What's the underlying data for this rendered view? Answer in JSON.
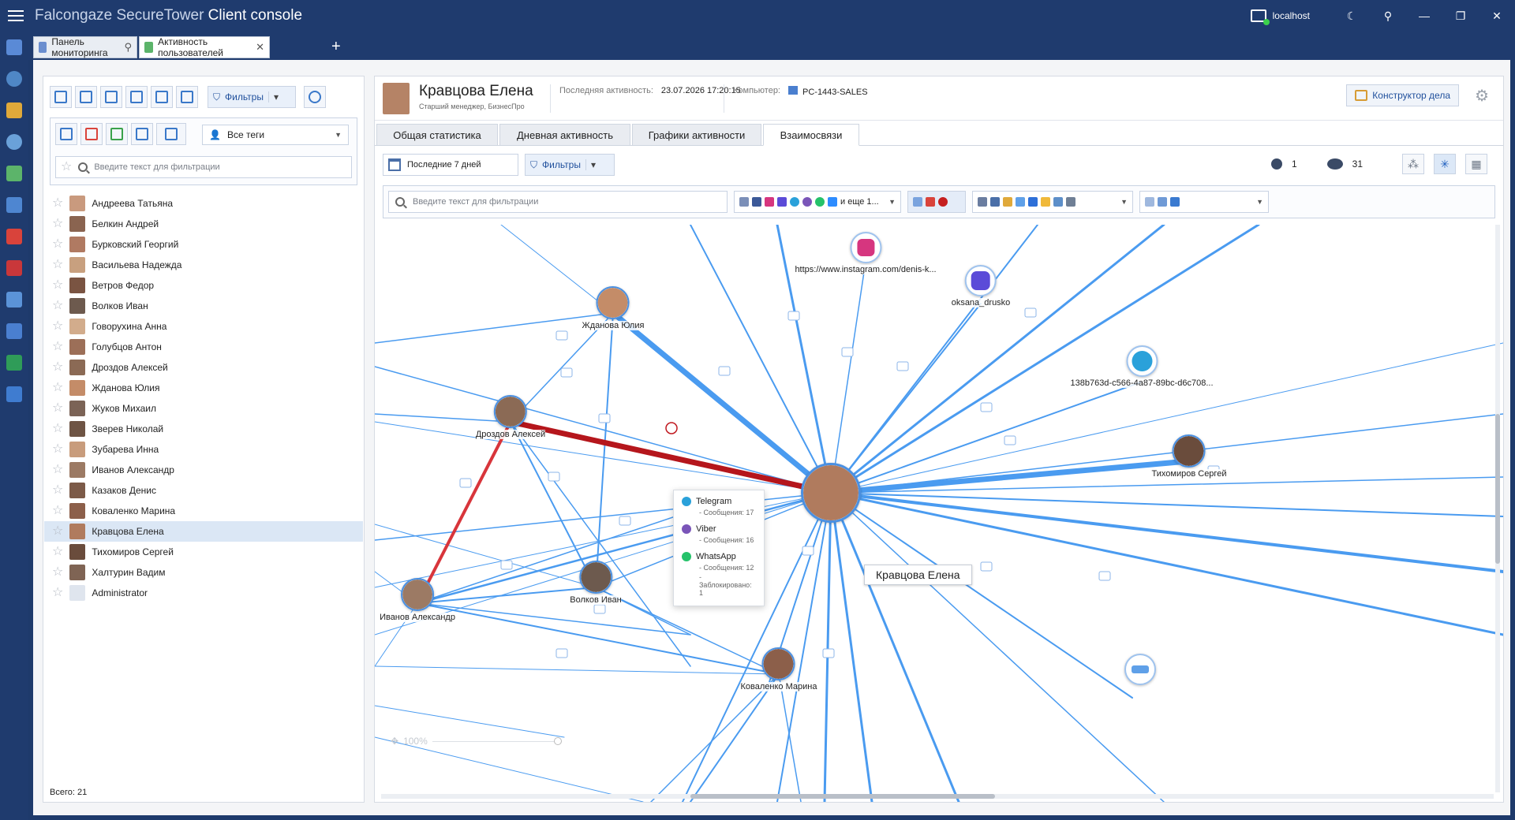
{
  "app": {
    "title_brand": "Falcongaze SecureTower",
    "title_product": "Client console",
    "server": "localhost"
  },
  "doc_tabs": [
    {
      "label": "Панель мониторинга",
      "icon": "monitoring-icon",
      "pinned": true
    },
    {
      "label": "Активность пользователей",
      "icon": "user-activity-icon",
      "closable": true
    }
  ],
  "left_panel": {
    "filter_button": "Фильтры",
    "tags_select": "Все теги",
    "search_placeholder": "Введите текст для фильтрации",
    "users": [
      "Андреева Татьяна",
      "Белкин Андрей",
      "Бурковский Георгий",
      "Васильева Надежда",
      "Ветров Федор",
      "Волков Иван",
      "Говорухина Анна",
      "Голубцов Антон",
      "Дроздов Алексей",
      "Жданова Юлия",
      "Жуков Михаил",
      "Зверев Николай",
      "Зубарева Инна",
      "Иванов Александр",
      "Казаков Денис",
      "Коваленко Марина",
      "Кравцова Елена",
      "Тихомиров Сергей",
      "Халтурин Вадим",
      "Administrator"
    ],
    "selected_user": "Кравцова Елена",
    "total": "Всего: 21"
  },
  "header": {
    "name": "Кравцова Елена",
    "role": "Старший менеджер, БизнесПро",
    "last_activity_label": "Последняя активность:",
    "last_activity_value": "23.07.2026 17:20:15",
    "computer_label": "Компьютер:",
    "computer_value": "PC-1443-SALES",
    "constructor_button": "Конструктор дела"
  },
  "view_tabs": [
    "Общая статистика",
    "Дневная активность",
    "Графики активности",
    "Взаимосвязи"
  ],
  "active_view_tab": "Взаимосвязи",
  "toolbar": {
    "period": "Последние 7 дней",
    "filters": "Фильтры",
    "count_users": "1",
    "count_groups": "31",
    "search_placeholder": "Введите текст для фильтрации",
    "channels_more": "и еще 1..."
  },
  "graph": {
    "center": "Кравцова Елена",
    "nodes": [
      "Жданова Юлия",
      "Дроздов Алексей",
      "Волков Иван",
      "Иванов Александр",
      "Коваленко Марина",
      "Тихомиров Сергей"
    ],
    "external": [
      "https://www.instagram.com/denis-k...",
      "oksana_drusko",
      "138b763d-c566-4a87-89bc-d6c708..."
    ],
    "zoom": "100%"
  },
  "tooltip": {
    "telegram": "Telegram",
    "telegram_sub": "- Сообщения: 17",
    "viber": "Viber",
    "viber_sub": "- Сообщения: 16",
    "whatsapp": "WhatsApp",
    "whatsapp_sub1": "- Сообщения: 12",
    "whatsapp_sub2": "- Заблокировано: 1"
  },
  "colors": {
    "titlebar": "#1f3b6e",
    "edge": "#4a9bf0",
    "edge_risk": "#c0181f",
    "accent": "#1f5fbf"
  }
}
